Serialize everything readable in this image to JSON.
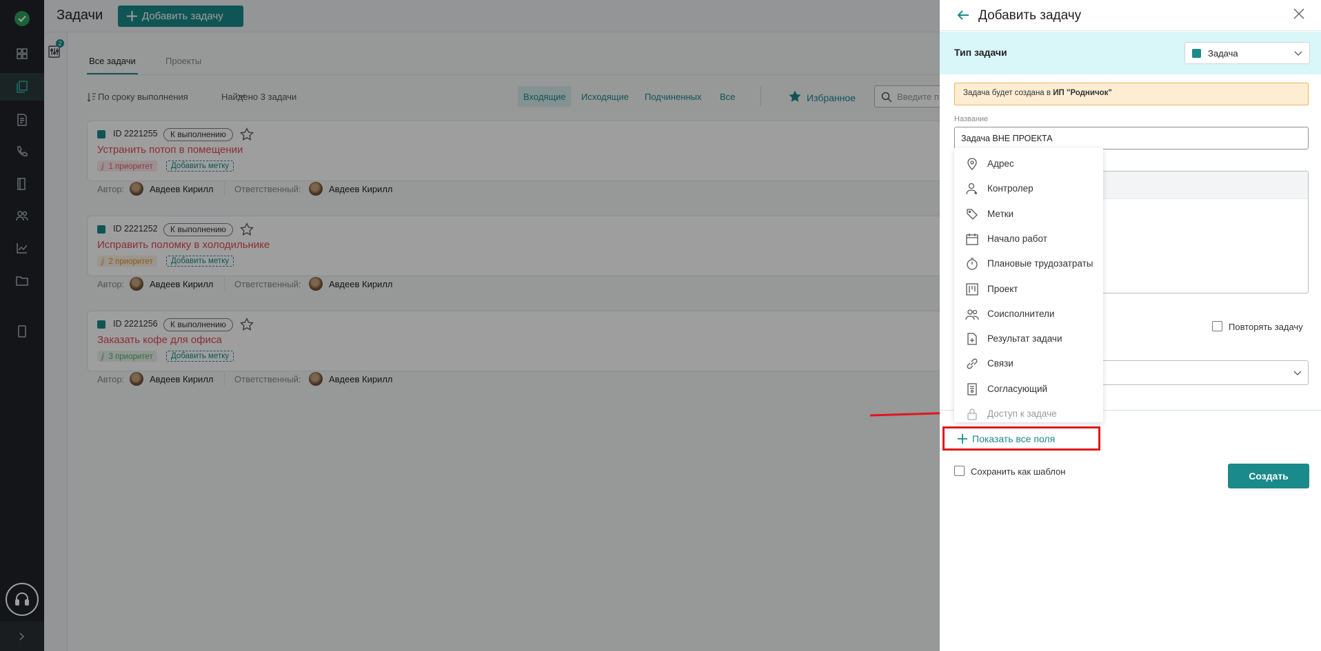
{
  "header": {
    "title": "Задачи",
    "add_button": "Добавить задачу",
    "filter_badge": "2"
  },
  "tabs": [
    {
      "label": "Все задачи",
      "active": true
    },
    {
      "label": "Проекты",
      "active": false
    }
  ],
  "toolbar": {
    "sort_label": "По сроку выполнения",
    "found_text": "Найдено 3 задачи",
    "filters": [
      "Входящие",
      "Исходящие",
      "Подчиненных",
      "Все"
    ],
    "favorites_label": "Избранное",
    "search_placeholder": "Введите п"
  },
  "tasks": [
    {
      "id": "ID 2221255",
      "status": "К выполнению",
      "title": "Устранить потоп в помещении",
      "priority": "1 приоритет",
      "priority_color": "#e05a6e",
      "add_tag": "Добавить метку",
      "author_label": "Автор:",
      "author": "Авдеев Кирилл",
      "responsible_label": "Ответственный:",
      "responsible": "Авдеев Кирилл"
    },
    {
      "id": "ID 2221252",
      "status": "К выполнению",
      "title": "Исправить поломку в холодильнике",
      "priority": "2 приоритет",
      "priority_color": "#e0922a",
      "add_tag": "Добавить метку",
      "author_label": "Автор:",
      "author": "Авдеев Кирилл",
      "responsible_label": "Ответственный:",
      "responsible": "Авдеев Кирилл"
    },
    {
      "id": "ID 2221256",
      "status": "К выполнению",
      "title": "Заказать кофе для офиса",
      "priority": "3 приоритет",
      "priority_color": "#5aa86a",
      "add_tag": "Добавить метку",
      "author_label": "Автор:",
      "author": "Авдеев Кирилл",
      "responsible_label": "Ответственный:",
      "responsible": "Авдеев Кирилл"
    }
  ],
  "panel": {
    "title": "Добавить задачу",
    "type_label": "Тип задачи",
    "type_value": "Задача",
    "notice_prefix": "Задача будет создана в ",
    "notice_org": "ИП \"Родничок\"",
    "name_label": "Название",
    "name_value": "Задача ВНЕ ПРОЕКТА",
    "repeat_label": "Повторять задачу",
    "show_all_fields": "Показать все поля",
    "save_template": "Сохранить как шаблон",
    "create_button": "Создать"
  },
  "field_menu": [
    {
      "label": "Адрес",
      "icon": "pin-icon"
    },
    {
      "label": "Контролер",
      "icon": "user-plus-icon"
    },
    {
      "label": "Метки",
      "icon": "tag-icon"
    },
    {
      "label": "Начало работ",
      "icon": "calendar-icon"
    },
    {
      "label": "Плановые трудозатраты",
      "icon": "stopwatch-icon"
    },
    {
      "label": "Проект",
      "icon": "kanban-icon"
    },
    {
      "label": "Соисполнители",
      "icon": "users-icon"
    },
    {
      "label": "Результат задачи",
      "icon": "document-plus-icon"
    },
    {
      "label": "Связи",
      "icon": "link-icon"
    },
    {
      "label": "Согласующий",
      "icon": "approver-icon"
    },
    {
      "label": "Доступ к задаче",
      "icon": "lock-icon",
      "disabled": true
    }
  ],
  "colors": {
    "accent": "#1b8a8a",
    "highlight_red": "#e0161c",
    "nav_bg": "#1f2328"
  }
}
